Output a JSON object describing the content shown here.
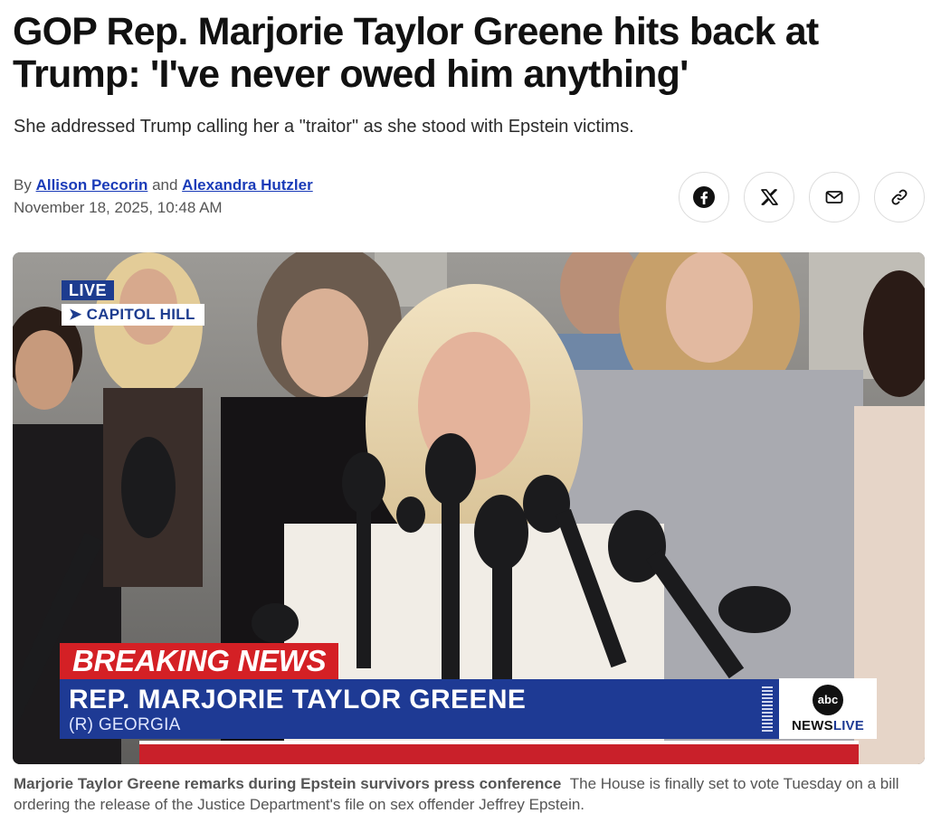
{
  "article": {
    "headline": "GOP Rep. Marjorie Taylor Greene hits back at Trump: 'I've never owed him anything'",
    "dek": "She addressed Trump calling her a \"traitor\" as she stood with Epstein victims.",
    "byline": {
      "prefix": "By",
      "author1": "Allison Pecorin",
      "conjunction": "and",
      "author2": "Alexandra Hutzler"
    },
    "timestamp": "November 18, 2025, 10:48 AM"
  },
  "share": [
    {
      "name": "facebook",
      "icon": "facebook-icon"
    },
    {
      "name": "x",
      "icon": "x-icon"
    },
    {
      "name": "email",
      "icon": "mail-icon"
    },
    {
      "name": "copy-link",
      "icon": "link-icon"
    }
  ],
  "video": {
    "live_label": "LIVE",
    "location_label": "➤ CAPITOL HILL",
    "breaking_label": "BREAKING NEWS",
    "lower_third_name": "REP. MARJORIE TAYLOR GREENE",
    "lower_third_sub": "(R) GEORGIA",
    "network_logo": "abc",
    "network_text_1": "NEWS",
    "network_text_2": "LIVE",
    "colors": {
      "breaking": "#d42025",
      "lower_third": "#1e3a94"
    }
  },
  "caption": {
    "title": "Marjorie Taylor Greene remarks during Epstein survivors press conference",
    "text": "The House is finally set to vote Tuesday on a bill ordering the release of the Justice Department's file on sex offender Jeffrey Epstein."
  }
}
